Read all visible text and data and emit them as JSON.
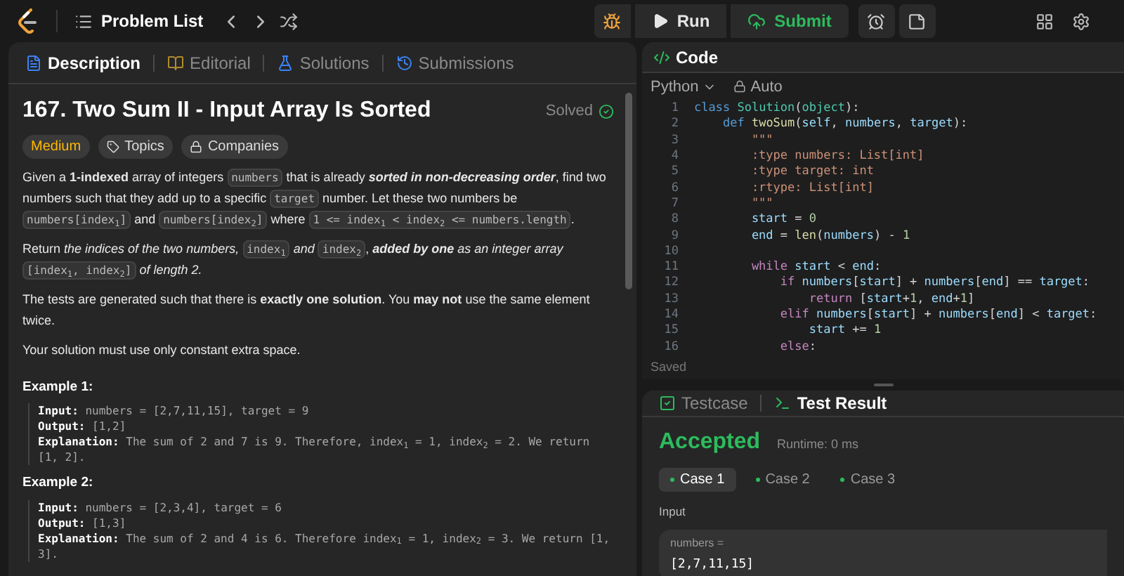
{
  "topbar": {
    "nav_label": "Problem List",
    "run_label": "Run",
    "submit_label": "Submit"
  },
  "description_tabs": [
    {
      "label": "Description",
      "kind": "description",
      "selected": true
    },
    {
      "label": "Editorial",
      "kind": "editorial",
      "selected": false
    },
    {
      "label": "Solutions",
      "kind": "solutions",
      "selected": false
    },
    {
      "label": "Submissions",
      "kind": "submissions",
      "selected": false
    }
  ],
  "problem": {
    "title": "167. Two Sum II - Input Array Is Sorted",
    "status": "Solved",
    "difficulty": "Medium",
    "tags": [
      {
        "label": "Topics",
        "kind": "tag"
      },
      {
        "label": "Companies",
        "kind": "lock"
      }
    ],
    "paragraphs": [
      [
        {
          "kind": "text",
          "t": "Given a **1-indexed** array of integers "
        },
        {
          "kind": "code",
          "t": "numbers"
        },
        {
          "kind": "text",
          "t": " that is already "
        },
        {
          "kind": "strongem",
          "t": "sorted in non-decreasing order"
        },
        {
          "kind": "text",
          "t": ", find two numbers such that they add up to a specific "
        },
        {
          "kind": "code",
          "t": "target"
        },
        {
          "kind": "text",
          "t": " number. Let these two numbers be "
        },
        {
          "kind": "code",
          "t": "numbers[index$_{1}$]"
        },
        {
          "kind": "text",
          "t": " and "
        },
        {
          "kind": "code",
          "t": "numbers[index$_{2}$]"
        },
        {
          "kind": "text",
          "t": " where "
        },
        {
          "kind": "code",
          "t": "1 <= index$_{1}$ < index$_{2}$ <= numbers.length"
        },
        {
          "kind": "text",
          "t": "."
        }
      ],
      [
        {
          "kind": "text",
          "t": "Return *the indices of the two numbers,* "
        },
        {
          "kind": "code",
          "t": "index$_{1}$"
        },
        {
          "kind": "text",
          "t": " *and* "
        },
        {
          "kind": "code",
          "t": "index$_{2}$"
        },
        {
          "kind": "text",
          "t": ", "
        },
        {
          "kind": "strongem",
          "t": "added by one"
        },
        {
          "kind": "text",
          "t": " *as an integer array* "
        },
        {
          "kind": "code",
          "t": "[index$_{1}$, index$_{2}$]"
        },
        {
          "kind": "text",
          "t": " *of length 2.*"
        }
      ],
      [
        {
          "kind": "text",
          "t": "The tests are generated such that there is **exactly one solution**. You **may not** use the same element twice."
        }
      ],
      [
        {
          "kind": "text",
          "t": "Your solution must use only constant extra space."
        }
      ]
    ],
    "examples": [
      {
        "heading": "Example 1:",
        "lines": [
          {
            "label": "Input:",
            "value": "numbers = [2,7,11,15], target = 9"
          },
          {
            "label": "Output:",
            "value": "[1,2]"
          },
          {
            "label": "Explanation:",
            "value": "The sum of 2 and 7 is 9. Therefore, index$_{1}$ = 1, index$_{2}$ = 2. We return [1, 2]."
          }
        ]
      },
      {
        "heading": "Example 2:",
        "lines": [
          {
            "label": "Input:",
            "value": "numbers = [2,3,4], target = 6"
          },
          {
            "label": "Output:",
            "value": "[1,3]"
          },
          {
            "label": "Explanation:",
            "value": "The sum of 2 and 4 is 6. Therefore index$_{1}$ = 1, index$_{2}$ = 3. We return [1, 3]."
          }
        ]
      }
    ]
  },
  "editor": {
    "tab": "Code",
    "language": "Python",
    "mode": "Auto",
    "status": "Saved",
    "lines": [
      {
        "n": "1",
        "tokens": [
          {
            "t": "class ",
            "kind": "kw"
          },
          {
            "t": "Solution",
            "kind": "cls"
          },
          {
            "t": "(",
            "kind": "p"
          },
          {
            "t": "object",
            "kind": "cls"
          },
          {
            "t": "):",
            "kind": "p"
          }
        ]
      },
      {
        "n": "2",
        "tokens": [
          {
            "t": "    def ",
            "kind": "kw"
          },
          {
            "t": "twoSum",
            "kind": "fn"
          },
          {
            "t": "(",
            "kind": "p"
          },
          {
            "t": "self",
            "kind": "var"
          },
          {
            "t": ", ",
            "kind": "p"
          },
          {
            "t": "numbers",
            "kind": "var"
          },
          {
            "t": ", ",
            "kind": "p"
          },
          {
            "t": "target",
            "kind": "var"
          },
          {
            "t": "):",
            "kind": "p"
          }
        ]
      },
      {
        "n": "3",
        "tokens": [
          {
            "t": "        \"\"\"",
            "kind": "str"
          }
        ]
      },
      {
        "n": "4",
        "tokens": [
          {
            "t": "        :type numbers: List[int]",
            "kind": "str"
          }
        ]
      },
      {
        "n": "5",
        "tokens": [
          {
            "t": "        :type target: int",
            "kind": "str"
          }
        ]
      },
      {
        "n": "6",
        "tokens": [
          {
            "t": "        :rtype: List[int]",
            "kind": "str"
          }
        ]
      },
      {
        "n": "7",
        "tokens": [
          {
            "t": "        \"\"\"",
            "kind": "str"
          }
        ]
      },
      {
        "n": "8",
        "tokens": [
          {
            "t": "        start",
            "kind": "var"
          },
          {
            "t": " = ",
            "kind": "p"
          },
          {
            "t": "0",
            "kind": "num"
          }
        ]
      },
      {
        "n": "9",
        "tokens": [
          {
            "t": "        end",
            "kind": "var"
          },
          {
            "t": " = ",
            "kind": "p"
          },
          {
            "t": "len",
            "kind": "fn"
          },
          {
            "t": "(",
            "kind": "p"
          },
          {
            "t": "numbers",
            "kind": "var"
          },
          {
            "t": ") - ",
            "kind": "p"
          },
          {
            "t": "1",
            "kind": "num"
          }
        ]
      },
      {
        "n": "10"
      },
      {
        "n": "11",
        "tokens": [
          {
            "t": "        while ",
            "kind": "ctrl"
          },
          {
            "t": "start",
            "kind": "var"
          },
          {
            "t": " < ",
            "kind": "p"
          },
          {
            "t": "end",
            "kind": "var"
          },
          {
            "t": ":",
            "kind": "p"
          }
        ]
      },
      {
        "n": "12",
        "tokens": [
          {
            "t": "            if ",
            "kind": "ctrl"
          },
          {
            "t": "numbers",
            "kind": "var"
          },
          {
            "t": "[",
            "kind": "p"
          },
          {
            "t": "start",
            "kind": "var"
          },
          {
            "t": "] + ",
            "kind": "p"
          },
          {
            "t": "numbers",
            "kind": "var"
          },
          {
            "t": "[",
            "kind": "p"
          },
          {
            "t": "end",
            "kind": "var"
          },
          {
            "t": "] == ",
            "kind": "p"
          },
          {
            "t": "target",
            "kind": "var"
          },
          {
            "t": ":",
            "kind": "p"
          }
        ]
      },
      {
        "n": "13",
        "tokens": [
          {
            "t": "                return ",
            "kind": "ctrl"
          },
          {
            "t": "[",
            "kind": "p"
          },
          {
            "t": "start",
            "kind": "var"
          },
          {
            "t": "+",
            "kind": "p"
          },
          {
            "t": "1",
            "kind": "num"
          },
          {
            "t": ", ",
            "kind": "p"
          },
          {
            "t": "end",
            "kind": "var"
          },
          {
            "t": "+",
            "kind": "p"
          },
          {
            "t": "1",
            "kind": "num"
          },
          {
            "t": "]",
            "kind": "p"
          }
        ]
      },
      {
        "n": "14",
        "tokens": [
          {
            "t": "            elif ",
            "kind": "ctrl"
          },
          {
            "t": "numbers",
            "kind": "var"
          },
          {
            "t": "[",
            "kind": "p"
          },
          {
            "t": "start",
            "kind": "var"
          },
          {
            "t": "] + ",
            "kind": "p"
          },
          {
            "t": "numbers",
            "kind": "var"
          },
          {
            "t": "[",
            "kind": "p"
          },
          {
            "t": "end",
            "kind": "var"
          },
          {
            "t": "] < ",
            "kind": "p"
          },
          {
            "t": "target",
            "kind": "var"
          },
          {
            "t": ":",
            "kind": "p"
          }
        ]
      },
      {
        "n": "15",
        "tokens": [
          {
            "t": "                start",
            "kind": "var"
          },
          {
            "t": " += ",
            "kind": "p"
          },
          {
            "t": "1",
            "kind": "num"
          }
        ]
      },
      {
        "n": "16",
        "tokens": [
          {
            "t": "            else",
            "kind": "ctrl"
          },
          {
            "t": ":",
            "kind": "p"
          }
        ]
      }
    ]
  },
  "result": {
    "tabs": [
      {
        "label": "Testcase",
        "kind": "testcase",
        "selected": false
      },
      {
        "label": "Test Result",
        "kind": "result",
        "selected": true
      }
    ],
    "verdict": "Accepted",
    "runtime": "Runtime: 0 ms",
    "cases": [
      {
        "label": "Case 1",
        "selected": true
      },
      {
        "label": "Case 2",
        "selected": false
      },
      {
        "label": "Case 3",
        "selected": false
      }
    ],
    "input_heading": "Input",
    "param_name": "numbers =",
    "param_value": "[2,7,11,15]"
  }
}
